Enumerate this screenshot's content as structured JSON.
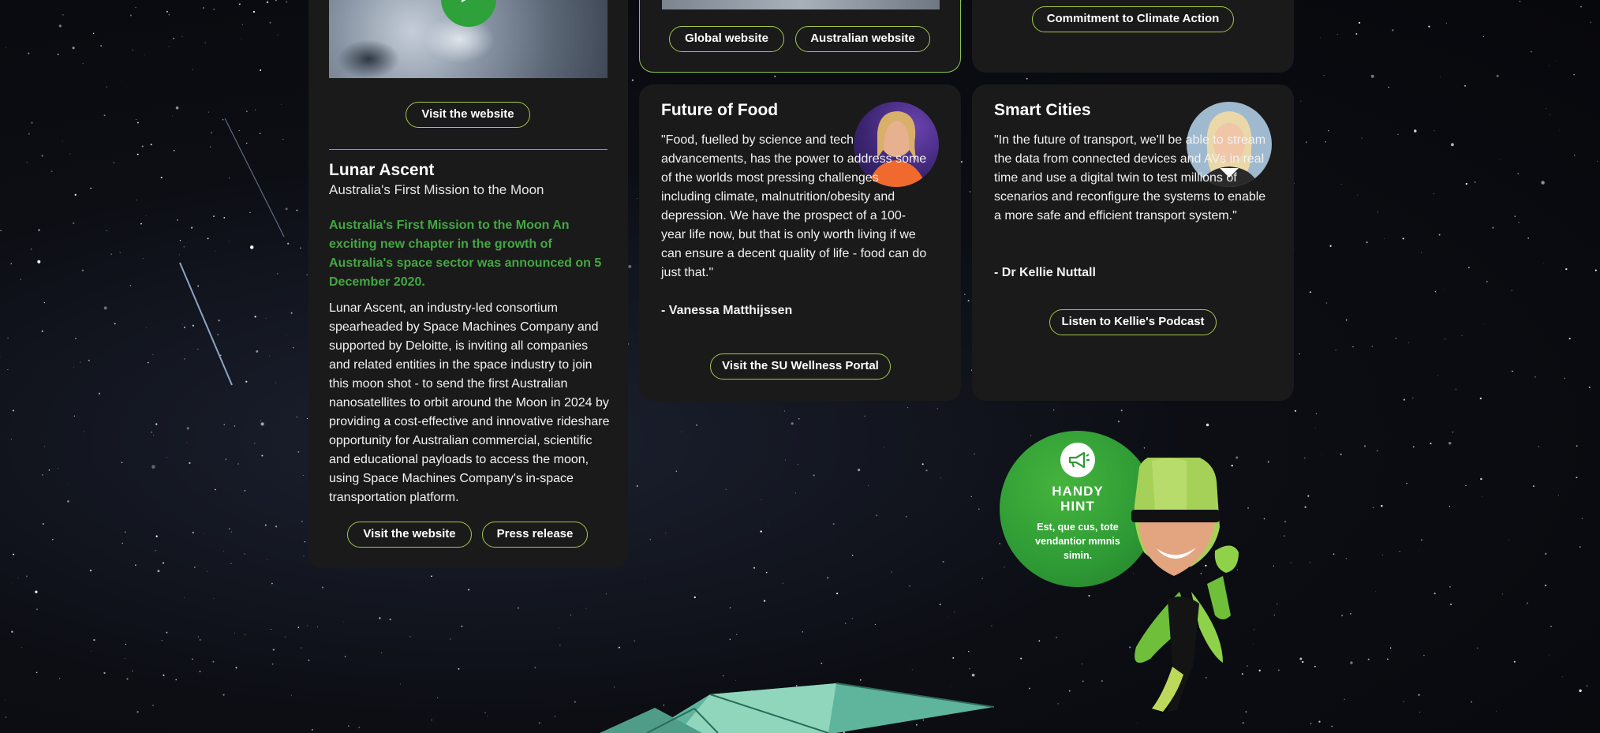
{
  "lunar_card": {
    "visit_top_label": "Visit the website",
    "title": "Lunar Ascent",
    "subtitle": "Australia's First Mission to the Moon",
    "highlight": "Australia's First Mission to the Moon An exciting new chapter in the growth of Australia's space sector was announced on 5 December 2020.",
    "body": "Lunar Ascent, an industry-led consortium spearheaded by Space Machines Company and supported by Deloitte, is inviting all companies and related entities in the space industry to join this moon shot - to send the first Australian nanosatellites to orbit around the Moon in 2024 by providing a cost-effective and innovative rideshare opportunity for Australian commercial, scientific and educational payloads to access the moon, using Space Machines Company's in-space transportation platform.",
    "visit_label": "Visit the website",
    "press_label": "Press release"
  },
  "top_middle_card": {
    "global_label": "Global website",
    "australian_label": "Australian website"
  },
  "top_right_card": {
    "climate_label": "Commitment to Climate Action"
  },
  "food_card": {
    "title": "Future of Food",
    "quote": "\"Food, fuelled by science and tech advancements, has the power to address some of the worlds most pressing challenges including climate, malnutrition/obesity and depression. We have the prospect of a 100-year life now, but that is only worth living if we can ensure a decent quality of life - food can do just that.\"",
    "author": "- Vanessa Matthijssen",
    "button_label": "Visit the SU Wellness Portal"
  },
  "cities_card": {
    "title": "Smart Cities",
    "quote": "\"In the future of transport, we'll be able to stream the data from connected devices and AVs in real time and use a digital twin to test millions of scenarios and reconfigure the systems to enable a more safe and efficient transport system.\"",
    "author": "- Dr Kellie Nuttall",
    "button_label": "Listen to Kellie's Podcast"
  },
  "hint": {
    "title_line1": "HANDY",
    "title_line2": "HINT",
    "text": "Est, que cus, tote vendantior mmnis simin.",
    "icon": "megaphone-icon"
  },
  "colors": {
    "accent_green": "#43a842",
    "button_border": "#a4c84a",
    "card_bg": "#1a1a1a"
  }
}
